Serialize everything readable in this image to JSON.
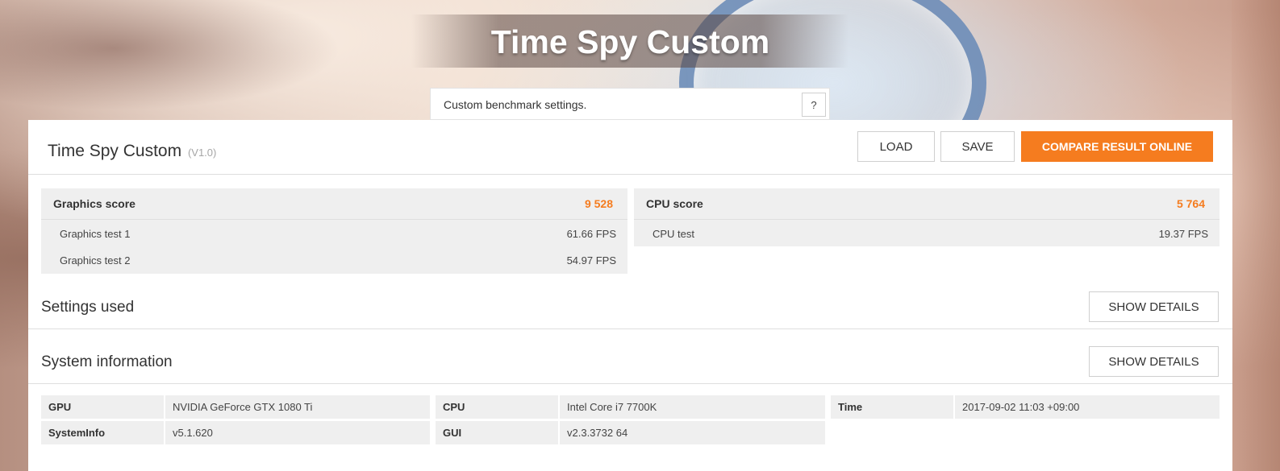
{
  "header": {
    "title": "Time Spy Custom",
    "description": "Custom benchmark settings.",
    "help_label": "?"
  },
  "panel": {
    "title": "Time Spy Custom",
    "version": "(V1.0)",
    "buttons": {
      "load": "LOAD",
      "save": "SAVE",
      "compare": "COMPARE RESULT ONLINE"
    }
  },
  "graphics": {
    "label": "Graphics score",
    "score": "9 528",
    "tests": [
      {
        "name": "Graphics test 1",
        "fps": "61.66 FPS"
      },
      {
        "name": "Graphics test 2",
        "fps": "54.97 FPS"
      }
    ]
  },
  "cpu": {
    "label": "CPU score",
    "score": "5 764",
    "tests": [
      {
        "name": "CPU test",
        "fps": "19.37 FPS"
      }
    ]
  },
  "sections": {
    "settings_title": "Settings used",
    "system_title": "System information",
    "details_label": "SHOW DETAILS"
  },
  "system_info": {
    "gpu_label": "GPU",
    "gpu_value": "NVIDIA GeForce GTX 1080 Ti",
    "sysinfo_label": "SystemInfo",
    "sysinfo_value": "v5.1.620",
    "cpu_label": "CPU",
    "cpu_value": "Intel Core i7 7700K",
    "gui_label": "GUI",
    "gui_value": "v2.3.3732 64",
    "time_label": "Time",
    "time_value": "2017-09-02 11:03 +09:00"
  },
  "colors": {
    "accent": "#f57c1f",
    "panel_bg": "#ffffff",
    "row_bg": "#efefef"
  }
}
